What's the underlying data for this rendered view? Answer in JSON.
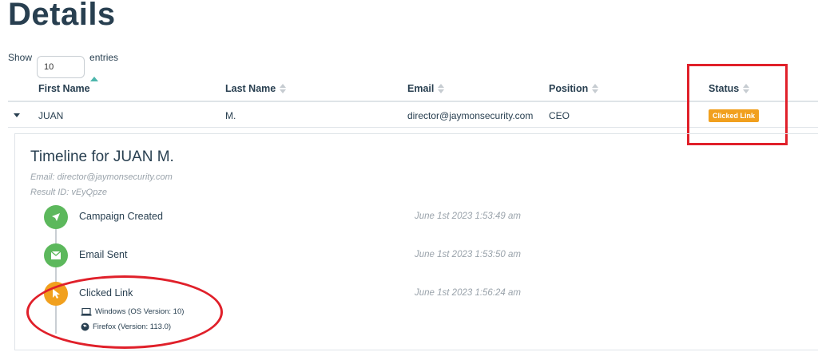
{
  "page": {
    "title": "Details"
  },
  "length_control": {
    "show_label": "Show",
    "value": "10",
    "entries_label": "entries"
  },
  "table": {
    "columns": [
      "First Name",
      "Last Name",
      "Email",
      "Position",
      "Status"
    ],
    "rows": [
      {
        "first": "JUAN",
        "last": "M.",
        "email": "director@jaymonsecurity.com",
        "position": "CEO",
        "status": "Clicked Link"
      }
    ]
  },
  "timeline": {
    "title": "Timeline for JUAN M.",
    "email_line": "Email: director@jaymonsecurity.com",
    "result_line": "Result ID: vEyQpze",
    "events": [
      {
        "label": "Campaign Created",
        "time": "June 1st 2023 1:53:49 am",
        "icon": "rocket-icon"
      },
      {
        "label": "Email Sent",
        "time": "June 1st 2023 1:53:50 am",
        "icon": "envelope-icon"
      },
      {
        "label": "Clicked Link",
        "time": "June 1st 2023 1:56:24 am",
        "icon": "cursor-icon",
        "details": [
          {
            "icon": "laptop-icon",
            "text": "Windows (OS Version: 10)"
          },
          {
            "icon": "firefox-icon",
            "text": "Firefox (Version: 113.0)"
          }
        ]
      }
    ]
  },
  "colors": {
    "success": "#5cb85c",
    "warning": "#f1a01e",
    "annotation": "#e0202a",
    "text": "#283f50"
  }
}
